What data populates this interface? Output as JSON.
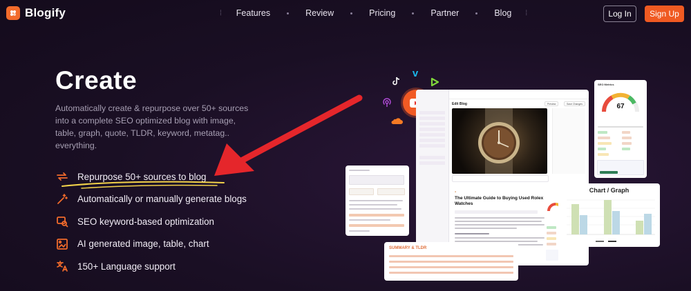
{
  "brand": {
    "name": "Blogify",
    "accent": "#f05a22"
  },
  "nav": {
    "items": [
      "Features",
      "Review",
      "Pricing",
      "Partner",
      "Blog"
    ]
  },
  "header": {
    "login_label": "Log In",
    "signup_label": "Sign Up"
  },
  "hero": {
    "title": "Create",
    "description": "Automatically create & repurpose over 50+ sources into a complete SEO optimized blog with image, table, graph, quote, TLDR, keyword, metatag.. everything.",
    "features": [
      {
        "icon": "repurpose-arrows-icon",
        "label": "Repurpose 50+ sources to blog"
      },
      {
        "icon": "magic-wand-icon",
        "label": "Automatically or manually generate blogs"
      },
      {
        "icon": "seo-search-icon",
        "label": "SEO keyword-based optimization"
      },
      {
        "icon": "image-chart-icon",
        "label": "AI generated image, table, chart"
      },
      {
        "icon": "translate-icon",
        "label": "150+ Language support"
      }
    ]
  },
  "preview": {
    "edit_title": "Edit Blog",
    "preview_btn": "Preview",
    "save_btn": "Save Changes",
    "article_title": "The Ultimate Guide to Buying Used Rolex Watches",
    "metrics_title": "SEO Metrics",
    "score": "67",
    "chart_title": "Chart / Graph",
    "summary_title": "SUMMARY & TLDR"
  }
}
